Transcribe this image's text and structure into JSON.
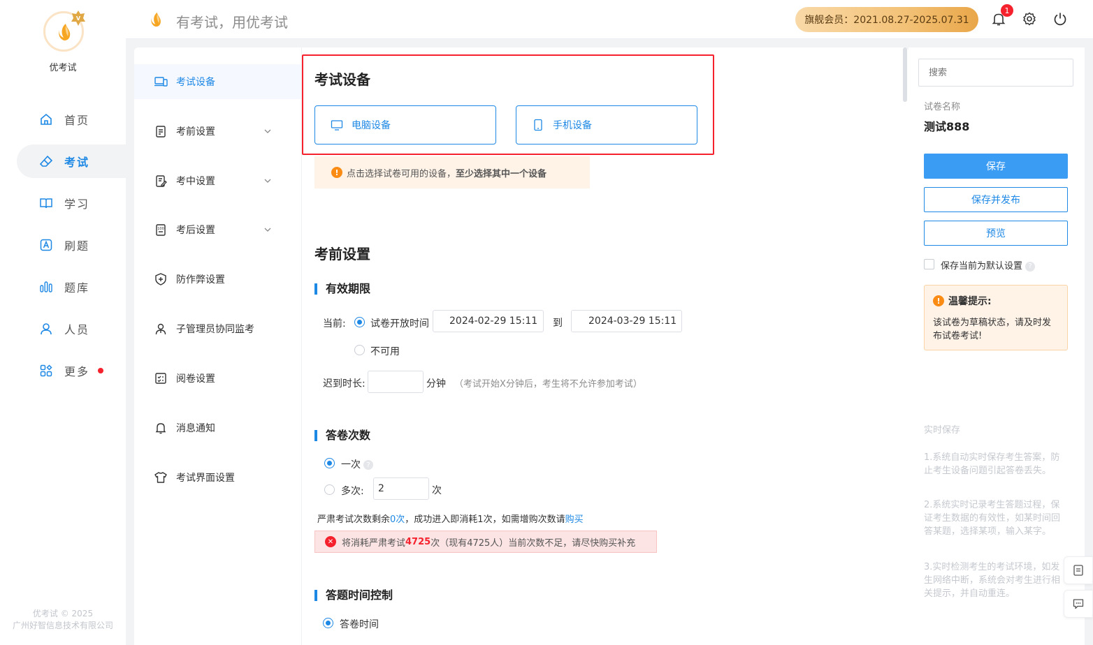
{
  "brand": {
    "name": "优考试"
  },
  "header": {
    "slogan": "有考试，用优考试",
    "member": "旗舰会员：2021.08.27-2025.07.31",
    "notifications": "1"
  },
  "nav": {
    "items": [
      {
        "label": "首页",
        "icon": "home-icon"
      },
      {
        "label": "考试",
        "icon": "eraser-icon",
        "active": true
      },
      {
        "label": "学习",
        "icon": "book-icon"
      },
      {
        "label": "刷题",
        "icon": "letter-a-icon"
      },
      {
        "label": "题库",
        "icon": "bars-icon"
      },
      {
        "label": "人员",
        "icon": "user-icon"
      },
      {
        "label": "更多",
        "icon": "apps-icon"
      }
    ],
    "copyright_line1": "优考试 © 2025",
    "copyright_line2": "广州好智信息技术有限公司"
  },
  "submenu": {
    "items": [
      {
        "label": "考试设备"
      },
      {
        "label": "考前设置"
      },
      {
        "label": "考中设置"
      },
      {
        "label": "考后设置"
      },
      {
        "label": "防作弊设置"
      },
      {
        "label": "子管理员协同监考"
      },
      {
        "label": "阅卷设置"
      },
      {
        "label": "消息通知"
      },
      {
        "label": "考试界面设置"
      }
    ]
  },
  "device": {
    "title": "考试设备",
    "pc": "电脑设备",
    "mobile": "手机设备",
    "tip_normal": "点击选择试卷可用的设备，",
    "tip_bold": "至少选择其中一个设备"
  },
  "pre": {
    "title": "考前设置",
    "validity": {
      "title": "有效期限",
      "current_label": "当前:",
      "option_open": "试卷开放时间",
      "start": "2024-02-29 15:11",
      "to": "到",
      "end": "2024-03-29 15:11",
      "option_unavailable": "不可用",
      "late_label": "迟到时长:",
      "late_unit": "分钟",
      "late_hint": "（考试开始X分钟后，考生将不允许参加考试）"
    },
    "attempts": {
      "title": "答卷次数",
      "once": "一次",
      "multi": "多次:",
      "multi_value": "2",
      "unit": "次",
      "strict_prefix": "严肃考试次数剩余",
      "strict_count": "0次",
      "strict_suffix": "，成功进入即消耗1次，如需增购次数请",
      "buy": "购买",
      "error_prefix": "将消耗严肃考试",
      "error_count": "4725",
      "error_suffix": "次（现有4725人）当前次数不足，请尽快购买补充"
    },
    "time": {
      "title": "答题时间控制",
      "option": "答卷时间"
    }
  },
  "right": {
    "search_placeholder": "搜索",
    "paper_label": "试卷名称",
    "paper_name": "测试888",
    "save": "保存",
    "save_publish": "保存并发布",
    "preview": "预览",
    "default_label": "保存当前为默认设置",
    "warm_title": "温馨提示:",
    "warm_body": "该试卷为草稿状态，请及时发布试卷考试!",
    "realtime_title": "实时保存",
    "realtime_1": "1.系统自动实时保存考生答案，防止考生设备问题引起答卷丢失。",
    "realtime_2": "2.系统实时记录考生答题过程，保证考生数据的有效性，如某时间回答某题，选择某项，输入某字。",
    "realtime_3": "3.实时检测考生的考试环境，如发生网络中断，系统会对考生进行相关提示，并自动重连。"
  },
  "colors": {
    "accent": "#1e88e5",
    "danger": "#f5222d",
    "warning": "#fa8c16",
    "gold": "#f3c277"
  }
}
